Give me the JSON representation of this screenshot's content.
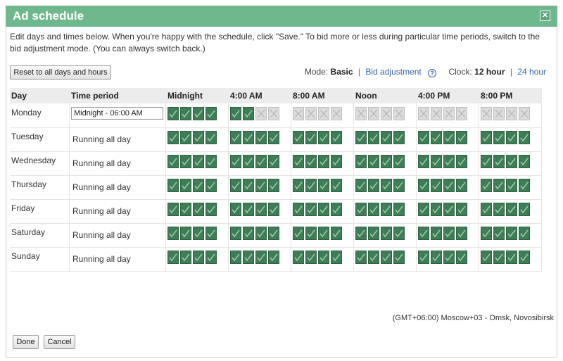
{
  "dialog": {
    "title": "Ad schedule",
    "close_label": "✕",
    "instructions": "Edit days and times below. When you're happy with the schedule, click \"Save.\" To bid more or less during particular time periods, switch to the bid adjustment mode. (You can always switch back.)",
    "reset_button": "Reset to all days and hours"
  },
  "mode": {
    "label": "Mode:",
    "current": "Basic",
    "alternate": "Bid adjustment",
    "help_icon": "?",
    "clock_label": "Clock:",
    "clock_current": "12 hour",
    "clock_alternate": "24 hour"
  },
  "grid": {
    "headers": {
      "day": "Day",
      "period": "Time period",
      "hours": [
        "Midnight",
        "4:00 AM",
        "8:00 AM",
        "Noon",
        "4:00 PM",
        "8:00 PM"
      ]
    },
    "rows": [
      {
        "day": "Monday",
        "period": "Midnight - 06:00 AM",
        "editing": true,
        "hours_on": 6
      },
      {
        "day": "Tuesday",
        "period": "Running all day",
        "editing": false,
        "hours_on": 24
      },
      {
        "day": "Wednesday",
        "period": "Running all day",
        "editing": false,
        "hours_on": 24
      },
      {
        "day": "Thursday",
        "period": "Running all day",
        "editing": false,
        "hours_on": 24
      },
      {
        "day": "Friday",
        "period": "Running all day",
        "editing": false,
        "hours_on": 24
      },
      {
        "day": "Saturday",
        "period": "Running all day",
        "editing": false,
        "hours_on": 24
      },
      {
        "day": "Sunday",
        "period": "Running all day",
        "editing": false,
        "hours_on": 24
      }
    ]
  },
  "timezone": "(GMT+06:00) Moscow+03 - Omsk, Novosibirsk",
  "footer": {
    "done": "Done",
    "cancel": "Cancel"
  },
  "colors": {
    "titlebar": "#6fb88e",
    "hour_on": "#3f7d57",
    "hour_off": "#dcdcdc",
    "link": "#3366aa"
  }
}
